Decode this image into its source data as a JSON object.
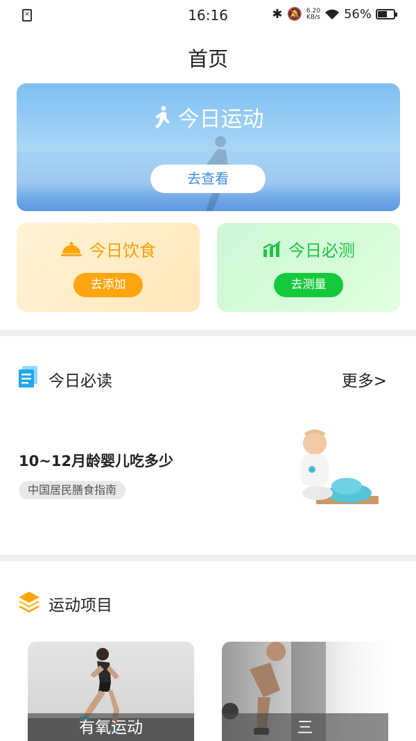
{
  "status": {
    "time": "16:16",
    "speed_value": "6.20",
    "speed_unit": "KB/s",
    "battery": "56%"
  },
  "header": {
    "title": "首页"
  },
  "sport_card": {
    "title": "今日运动",
    "button": "去查看"
  },
  "food_card": {
    "title": "今日饮食",
    "button": "去添加"
  },
  "test_card": {
    "title": "今日必测",
    "button": "去测量"
  },
  "reading": {
    "title": "今日必读",
    "more": "更多>",
    "article": {
      "title": "10~12月龄婴儿吃多少",
      "tag": "中国居民膳食指南"
    }
  },
  "exercise": {
    "title": "运动项目",
    "items": [
      {
        "label": "有氧运动"
      },
      {
        "label": "三"
      }
    ]
  },
  "colors": {
    "orange": "#ffa50f",
    "green": "#14c93b",
    "blue": "#3f8fe0"
  }
}
